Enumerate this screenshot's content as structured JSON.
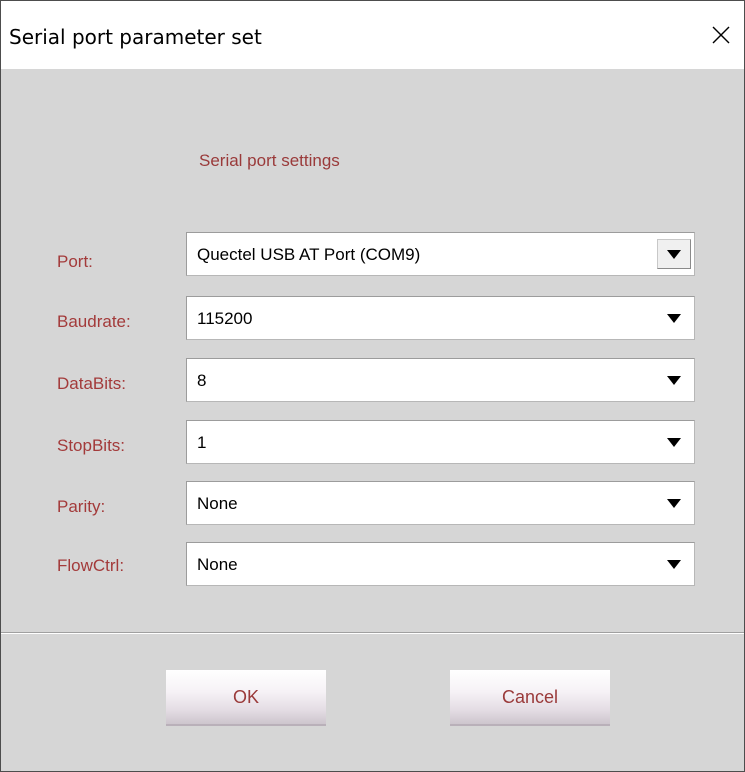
{
  "window": {
    "title": "Serial port parameter set",
    "close_icon": "close-icon"
  },
  "settings": {
    "heading": "Serial port settings",
    "fields": [
      {
        "label": "Port:",
        "value": "Quectel USB AT Port (COM9)"
      },
      {
        "label": "Baudrate:",
        "value": "115200"
      },
      {
        "label": "DataBits:",
        "value": "8"
      },
      {
        "label": "StopBits:",
        "value": "1"
      },
      {
        "label": "Parity:",
        "value": "None"
      },
      {
        "label": "FlowCtrl:",
        "value": "None"
      }
    ]
  },
  "buttons": {
    "ok_label": "OK",
    "cancel_label": "Cancel"
  },
  "colors": {
    "label_text": "#a33a3a",
    "client_background": "#d6d6d6",
    "title_background": "#ffffff"
  }
}
